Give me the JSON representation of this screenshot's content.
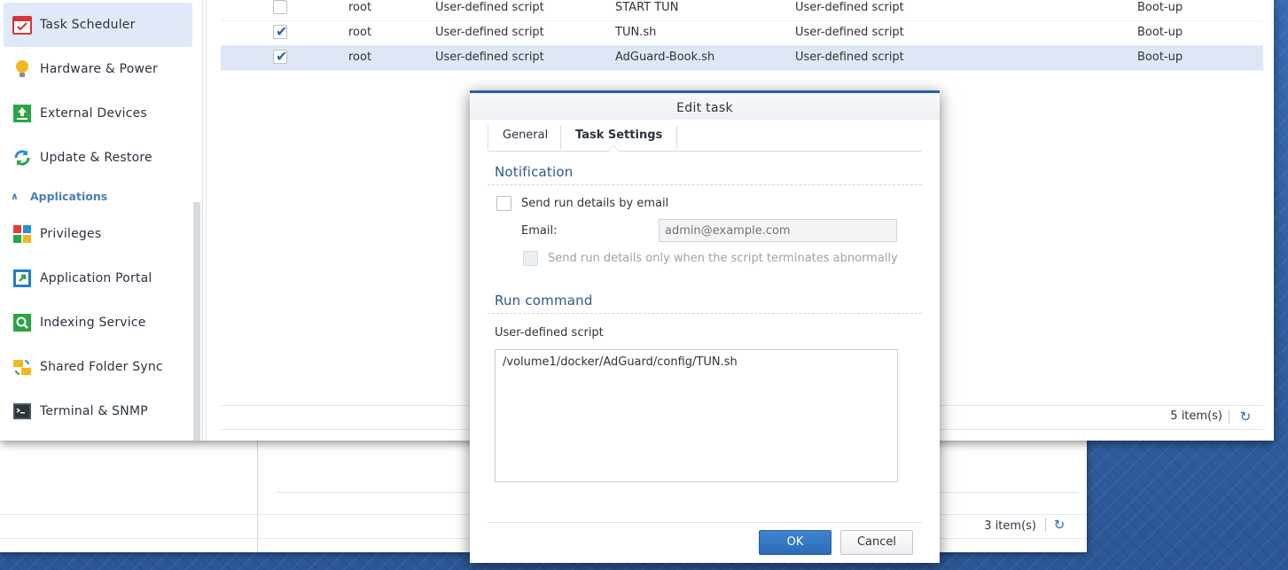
{
  "sidebar": {
    "items_top": [
      {
        "label": "Task Scheduler",
        "icon": "calendar-check-icon",
        "active": true
      },
      {
        "label": "Hardware & Power",
        "icon": "bulb-icon"
      },
      {
        "label": "External Devices",
        "icon": "upload-box-icon"
      },
      {
        "label": "Update & Restore",
        "icon": "sync-icon"
      }
    ],
    "section_header": "Applications",
    "items_apps": [
      {
        "label": "Privileges",
        "icon": "privileges-icon"
      },
      {
        "label": "Application Portal",
        "icon": "portal-icon"
      },
      {
        "label": "Indexing Service",
        "icon": "magnifier-icon"
      },
      {
        "label": "Shared Folder Sync",
        "icon": "folder-sync-icon"
      },
      {
        "label": "Terminal & SNMP",
        "icon": "terminal-icon"
      }
    ]
  },
  "tasks": {
    "rows": [
      {
        "checked": false,
        "owner": "root",
        "type": "User-defined script",
        "name": "START TUN",
        "action": "User-defined script",
        "schedule": "Boot-up"
      },
      {
        "checked": true,
        "owner": "root",
        "type": "User-defined script",
        "name": "TUN.sh",
        "action": "User-defined script",
        "schedule": "Boot-up"
      },
      {
        "checked": true,
        "owner": "root",
        "type": "User-defined script",
        "name": "AdGuard-Book.sh",
        "action": "User-defined script",
        "schedule": "Boot-up",
        "selected": true
      }
    ],
    "count": "5 item(s)"
  },
  "back_window": {
    "count": "3 item(s)"
  },
  "dialog": {
    "title": "Edit task",
    "tabs": [
      "General",
      "Task Settings"
    ],
    "notification": {
      "title": "Notification",
      "send_email_label": "Send run details by email",
      "email_label": "Email:",
      "email_placeholder": "admin@example.com",
      "abnormal_label": "Send run details only when the script terminates abnormally"
    },
    "run_command": {
      "title": "Run command",
      "script_label": "User-defined script",
      "script_value": "/volume1/docker/AdGuard/config/TUN.sh"
    },
    "ok_label": "OK",
    "cancel_label": "Cancel"
  },
  "colors": {
    "accent": "#2b5ea7",
    "selected_row": "#dde8f6",
    "active_side": "#dfe9f7"
  }
}
